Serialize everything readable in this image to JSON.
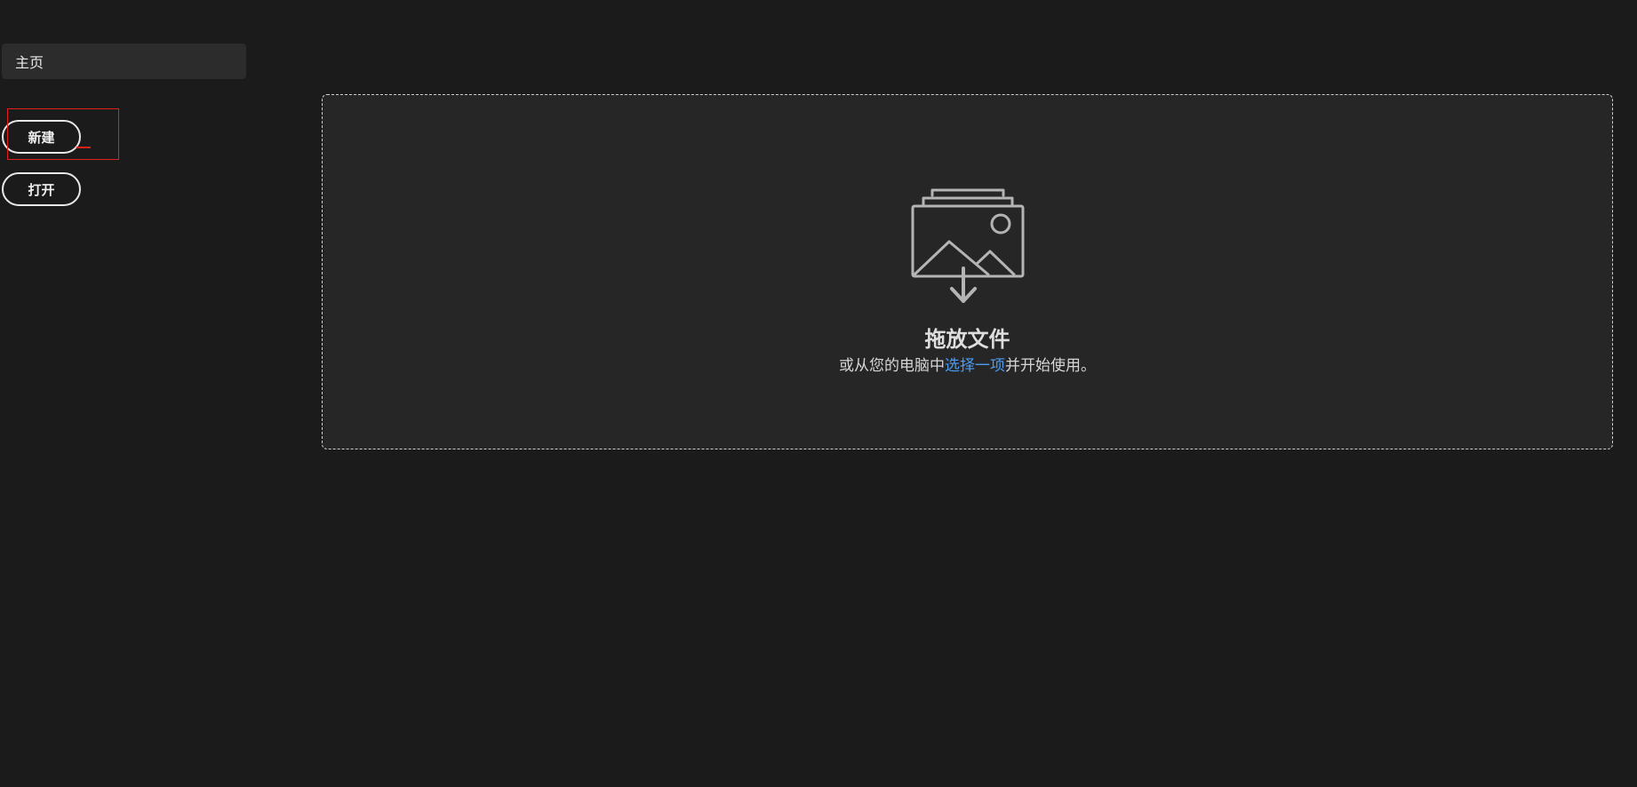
{
  "sidebar": {
    "home_label": "主页",
    "new_label": "新建",
    "open_label": "打开"
  },
  "dropzone": {
    "icon": "image-drop-icon",
    "title": "拖放文件",
    "subtitle_prefix": "或从您的电脑中",
    "subtitle_link": "选择一项",
    "subtitle_suffix": "并开始使用。"
  },
  "colors": {
    "background": "#1b1b1b",
    "panel": "#262626",
    "link": "#4b9cf5",
    "highlight": "#e0201c"
  }
}
